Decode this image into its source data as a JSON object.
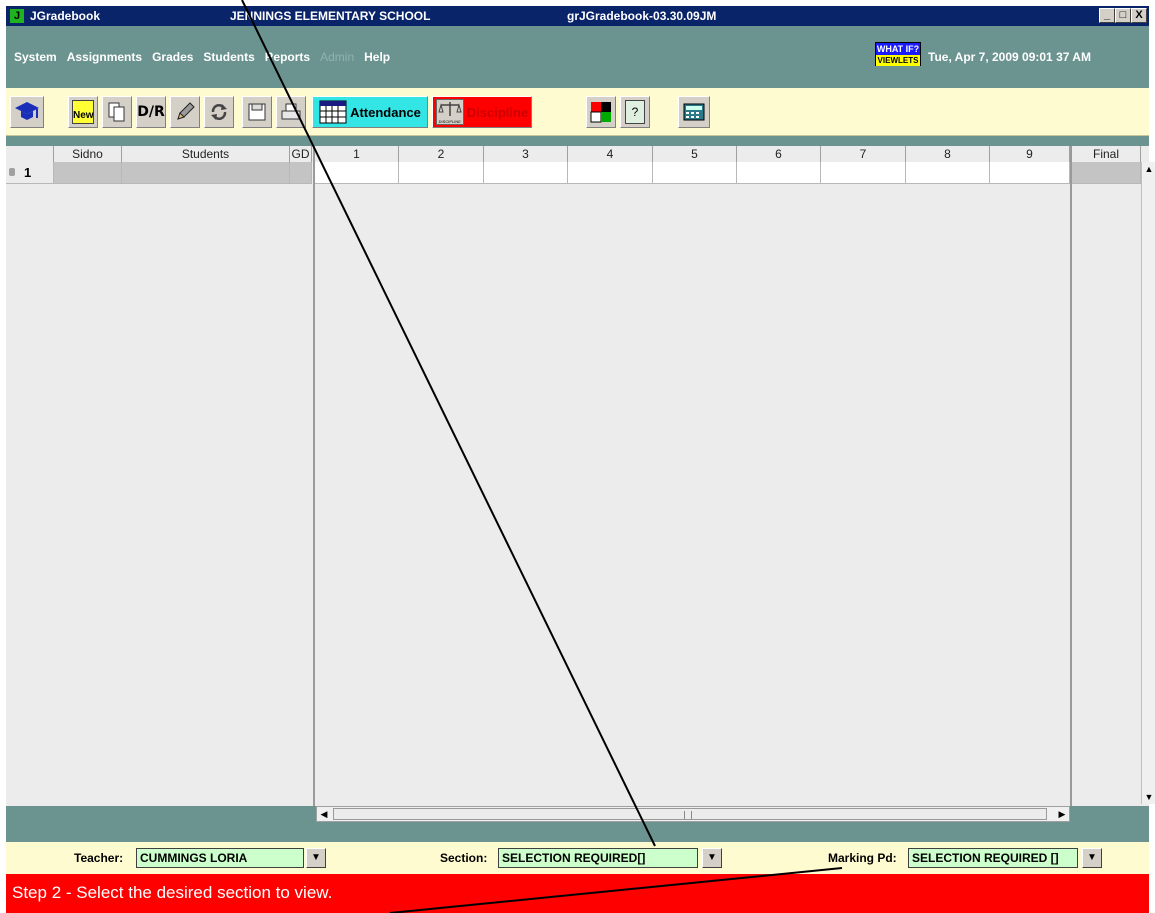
{
  "window": {
    "app_name": "JGradebook",
    "school_name": "JENNINGS ELEMENTARY SCHOOL",
    "version": "grJGradebook-03.30.09JM",
    "controls": [
      "_",
      "□",
      "X"
    ]
  },
  "menu": {
    "items": [
      "System",
      "Assignments",
      "Grades",
      "Students",
      "Reports",
      "Admin",
      "Help"
    ],
    "disabled": [
      "Admin"
    ],
    "whatif_top": "WHAT IF?",
    "whatif_bottom": "VIEWLETS",
    "datetime": "Tue, Apr 7, 2009  09:01 37 AM"
  },
  "toolbar": {
    "buttons": [
      "home-icon",
      "new-icon",
      "copy-icon",
      "dr-icon",
      "edit-icon",
      "refresh-icon",
      "save-icon",
      "print-icon",
      "attendance-icon",
      "discipline-icon",
      "color-icon",
      "help-icon",
      "calculator-icon"
    ],
    "new_label": "New",
    "dr_label": "D/R",
    "attendance_label": "Attendance",
    "discipline_label": "Discipline",
    "discipline_sub": "DISCIPLINE",
    "help_label": "?",
    "colors": {
      "attendance": "#33e5e5",
      "discipline": "#ff0000"
    }
  },
  "grid": {
    "columns": [
      "Sidno",
      "Students",
      "GD",
      "1",
      "2",
      "3",
      "4",
      "5",
      "6",
      "7",
      "8",
      "9",
      "Final"
    ],
    "row_number": "1"
  },
  "selectors": {
    "teacher_label": "Teacher:",
    "teacher_value": "CUMMINGS LORIA",
    "section_label": "Section:",
    "section_value": "SELECTION REQUIRED[]",
    "marking_label": "Marking Pd:",
    "marking_value": "SELECTION REQUIRED []"
  },
  "status": {
    "message": "Step 2 - Select the desired section to view."
  }
}
